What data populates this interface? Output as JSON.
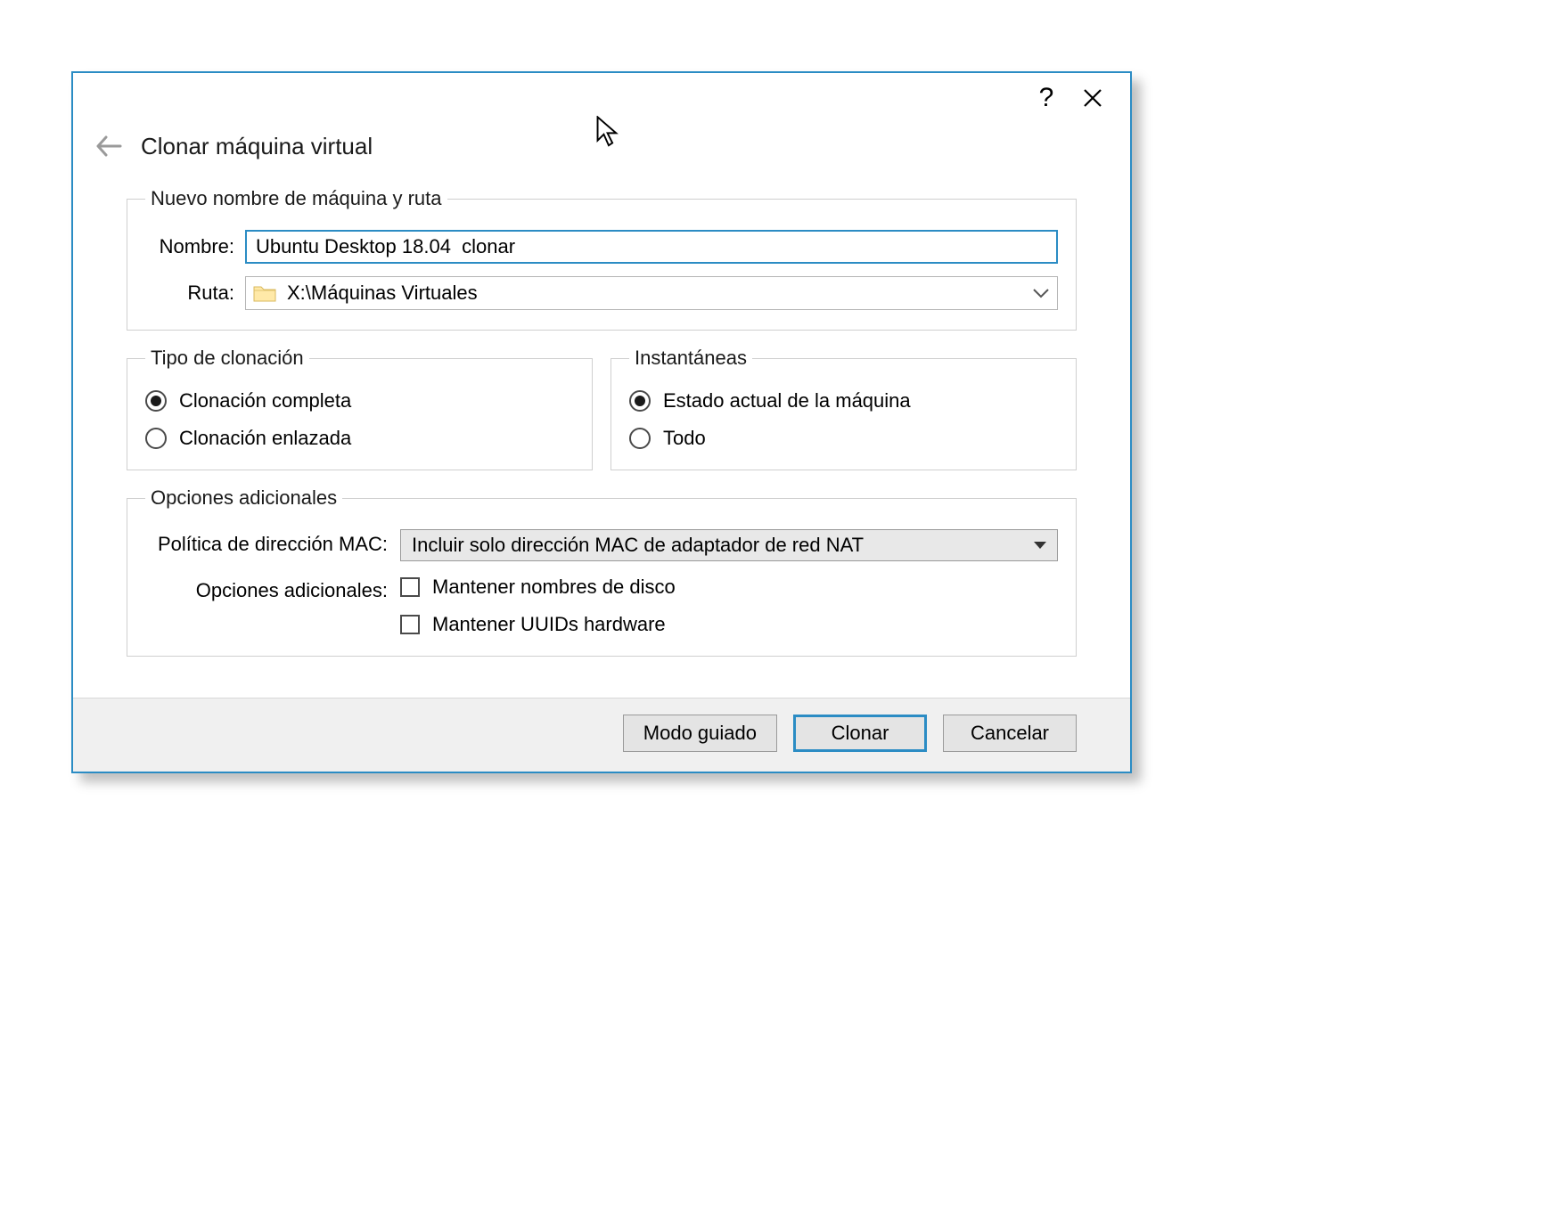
{
  "dialog": {
    "title": "Clonar máquina virtual"
  },
  "group_name_path": {
    "legend": "Nuevo nombre de máquina y ruta",
    "name_label": "Nombre:",
    "name_value": "Ubuntu Desktop 18.04  clonar",
    "path_label": "Ruta:",
    "path_value": "X:\\Máquinas Virtuales"
  },
  "group_clone_type": {
    "legend": "Tipo de clonación",
    "option_full": "Clonación completa",
    "option_linked": "Clonación enlazada",
    "selected": "full"
  },
  "group_snapshots": {
    "legend": "Instantáneas",
    "option_current": "Estado actual de la máquina",
    "option_all": "Todo",
    "selected": "current"
  },
  "group_additional": {
    "legend": "Opciones adicionales",
    "mac_policy_label": "Política de dirección MAC:",
    "mac_policy_value": "Incluir solo dirección MAC de adaptador de red NAT",
    "extra_options_label": "Opciones adicionales:",
    "check_keep_disk": "Mantener nombres de disco",
    "check_keep_uuid": "Mantener UUIDs hardware"
  },
  "footer": {
    "guided": "Modo guiado",
    "clone": "Clonar",
    "cancel": "Cancelar"
  }
}
